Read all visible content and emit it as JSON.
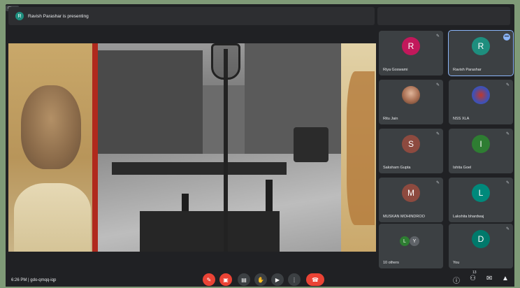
{
  "window": {
    "close_label": "Close"
  },
  "banner": {
    "avatar_letter": "R",
    "text": "Ravish Parashar is presenting"
  },
  "participants": [
    {
      "name": "Riya Goswami",
      "initial": "R",
      "color": "#c2185b",
      "active": false
    },
    {
      "name": "Ravish Parashar",
      "initial": "R",
      "color": "#1e8e7e",
      "active": true
    },
    {
      "name": "Ritu Jain",
      "initial": "",
      "color": "#b47b5b",
      "active": false
    },
    {
      "name": "NSS XLA",
      "initial": "",
      "color": "#3f51b5",
      "active": false
    },
    {
      "name": "Saksham Gupta",
      "initial": "S",
      "color": "#8d4a3f",
      "active": false
    },
    {
      "name": "Ishita Goel",
      "initial": "I",
      "color": "#2e7d32",
      "active": false
    },
    {
      "name": "MUSKAN MOHINDROO",
      "initial": "M",
      "color": "#8d4a3f",
      "active": false
    },
    {
      "name": "Lakshita bhardwaj",
      "initial": "L",
      "color": "#00897b",
      "active": false
    },
    {
      "name": "10 others",
      "initial": "",
      "color": "#3c4043",
      "active": false
    },
    {
      "name": "You",
      "initial": "D",
      "color": "#00796b",
      "active": false
    }
  ],
  "others_avatars": [
    {
      "initial": "L",
      "color": "#2e7d32"
    },
    {
      "initial": "Y",
      "color": "#5f6368"
    }
  ],
  "meeting": {
    "time": "6:26 PM",
    "separator": "|",
    "code": "gdo-qmqq-iqp"
  },
  "controls": {
    "mic_icon": "mic-off-icon",
    "cam_icon": "camera-off-icon",
    "captions_icon": "captions-icon",
    "hand_icon": "raise-hand-icon",
    "present_icon": "present-icon",
    "more_icon": "more-options-icon",
    "end_icon": "end-call-icon"
  },
  "right_controls": {
    "people_count": "13"
  },
  "colors": {
    "bg": "#202124",
    "tile": "#3c4043",
    "red": "#ea4335",
    "accent": "#8ab4f8"
  }
}
